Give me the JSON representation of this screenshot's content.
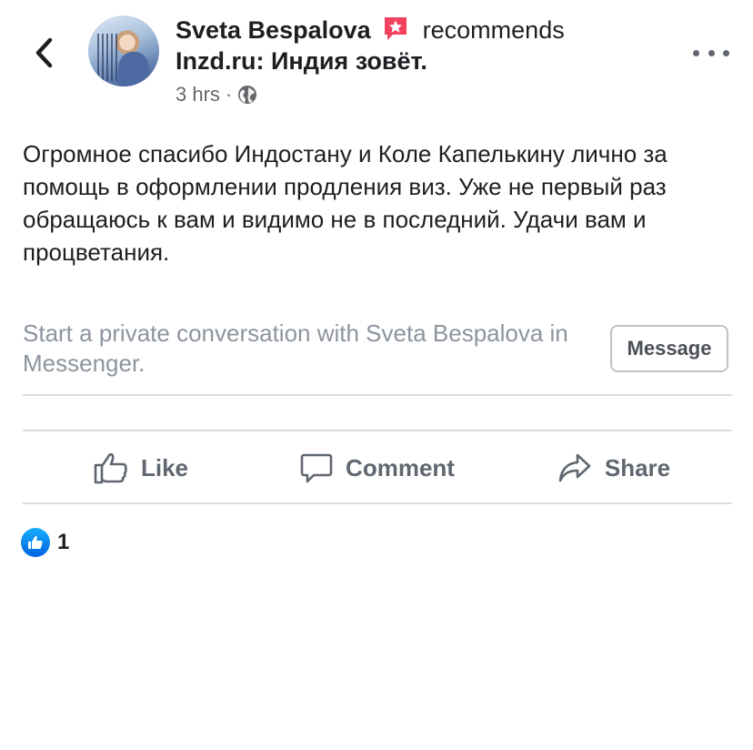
{
  "post": {
    "author": "Sveta Bespalova",
    "action_text": "recommends",
    "page_name": "Inzd.ru: Индия зовёт.",
    "timestamp": "3 hrs",
    "separator": "·",
    "body": "Огромное спасибо Индостану и Коле Капелькину лично за помощь в оформлении продления виз. Уже не первый раз обращаюсь к вам и видимо не в последний. Удачи вам и процветания."
  },
  "messenger": {
    "prompt": "Start a private conversation with Sveta Bespalova in Messenger.",
    "button_label": "Message"
  },
  "actions": {
    "like": "Like",
    "comment": "Comment",
    "share": "Share"
  },
  "reactions": {
    "count": "1"
  },
  "icons": {
    "back": "chevron-left-icon",
    "recommend": "star-badge-icon",
    "privacy": "globe-icon",
    "more": "more-dots-icon",
    "like": "thumbs-up-icon",
    "comment": "comment-bubble-icon",
    "share": "share-arrow-icon",
    "reaction": "like-reaction-icon"
  },
  "colors": {
    "recommend_badge": "#f3425f",
    "like_reaction": "#1877f2",
    "muted_text": "#8d949e"
  }
}
